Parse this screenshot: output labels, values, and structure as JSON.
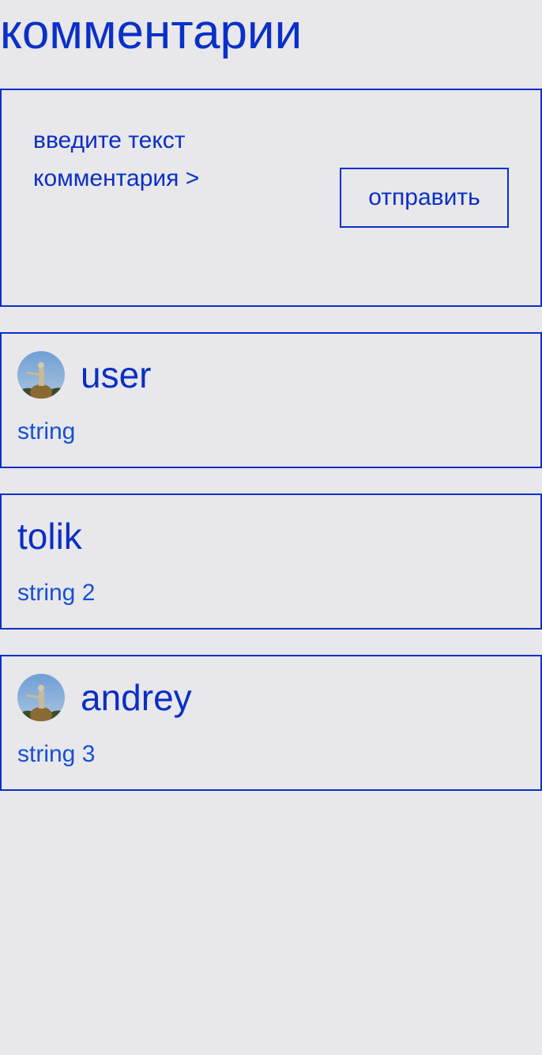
{
  "page": {
    "title": "комментарии"
  },
  "composer": {
    "placeholder": "введите текст комментария >",
    "send_label": "отправить"
  },
  "comments": [
    {
      "author": "user",
      "text": "string",
      "has_avatar": true
    },
    {
      "author": "tolik",
      "text": "string 2",
      "has_avatar": false
    },
    {
      "author": "andrey",
      "text": "string 3",
      "has_avatar": true
    }
  ],
  "colors": {
    "background": "#e8e7ea",
    "accent": "#0a30c8",
    "comment_text": "#1750d6"
  },
  "icons": {
    "avatar": "user-avatar-photo"
  }
}
